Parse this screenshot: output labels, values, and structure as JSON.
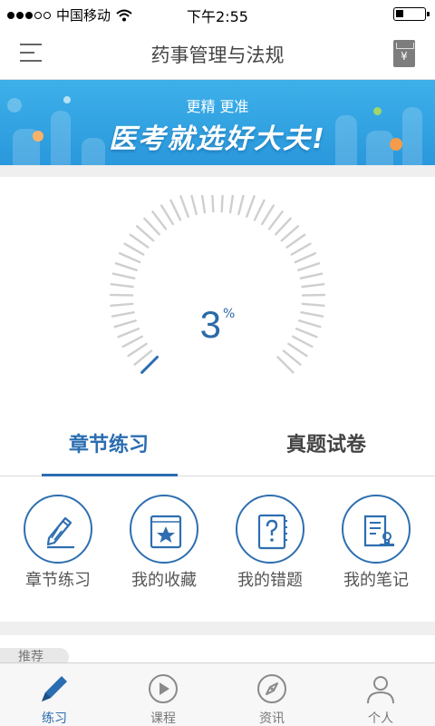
{
  "status_bar": {
    "carrier": "中国移动",
    "time": "下午2:55"
  },
  "nav": {
    "title": "药事管理与法规",
    "wallet_glyph": "¥"
  },
  "banner": {
    "subtitle": "更精 更准",
    "headline": "医考就选好大夫!"
  },
  "progress": {
    "value": "3",
    "unit": "%",
    "fraction": 0.03
  },
  "tabs": [
    {
      "label": "章节练习",
      "active": true
    },
    {
      "label": "真题试卷",
      "active": false
    }
  ],
  "features": [
    {
      "label": "章节练习",
      "icon": "pencil-icon"
    },
    {
      "label": "我的收藏",
      "icon": "star-book-icon"
    },
    {
      "label": "我的错题",
      "icon": "question-notebook-icon"
    },
    {
      "label": "我的笔记",
      "icon": "note-stamp-icon"
    }
  ],
  "recommend": {
    "label": "推荐"
  },
  "tab_bar": [
    {
      "label": "练习",
      "icon": "pencil-icon",
      "active": true
    },
    {
      "label": "课程",
      "icon": "play-circle-icon",
      "active": false
    },
    {
      "label": "资讯",
      "icon": "compass-icon",
      "active": false
    },
    {
      "label": "个人",
      "icon": "person-icon",
      "active": false
    }
  ],
  "colors": {
    "accent": "#2a6db0",
    "banner": "#2a98dc",
    "tick_inactive": "#cfcfcf"
  }
}
